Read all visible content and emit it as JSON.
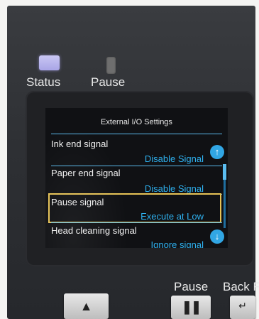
{
  "panel": {
    "status_label": "Status",
    "pause_label": "Pause",
    "bottom_pause_label": "Pause",
    "bottom_back_label": "Back F"
  },
  "screen": {
    "title": "External I/O Settings",
    "rows": [
      {
        "label": "Ink end signal",
        "value": "Disable Signal"
      },
      {
        "label": "Paper end signal",
        "value": "Disable Signal"
      },
      {
        "label": "Pause signal",
        "value": "Execute at Low"
      },
      {
        "label": "Head cleaning signal",
        "value": "Ignore signal"
      }
    ],
    "selected_index": 2
  },
  "icons": {
    "scroll_up": "arrow-up-icon",
    "scroll_down": "arrow-down-icon",
    "up_button": "triangle-up-icon",
    "pause_button": "pause-icon",
    "back_button": "back-icon"
  },
  "colors": {
    "accent": "#2eb0ee",
    "selection": "#e6c356",
    "status_led": "#b0adf0"
  }
}
